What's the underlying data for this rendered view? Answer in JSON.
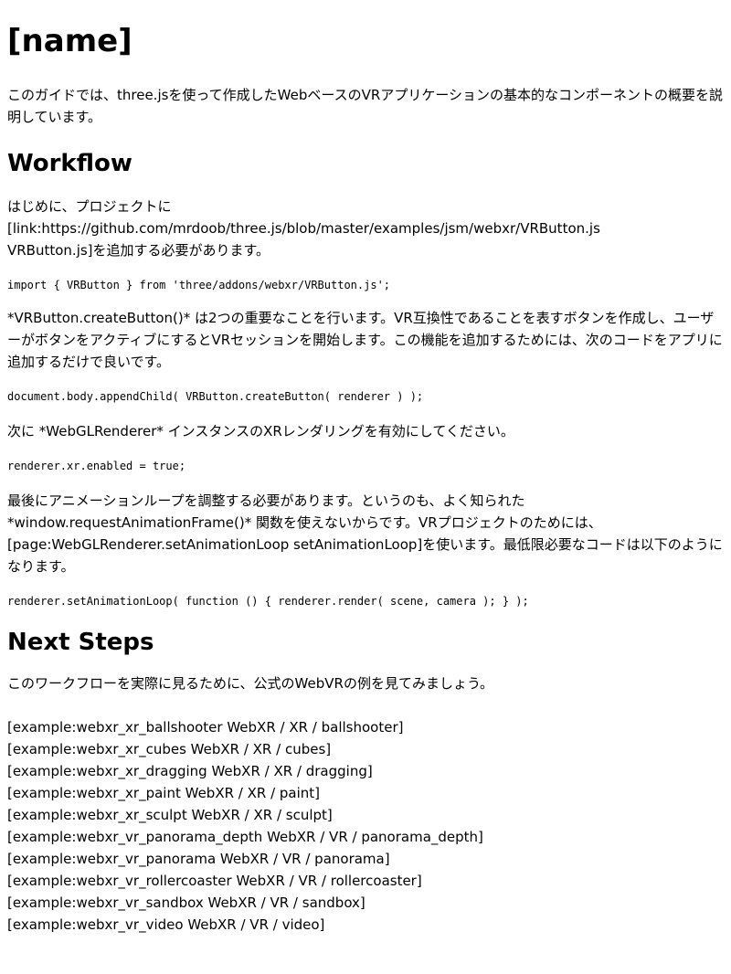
{
  "title": "[name]",
  "intro": "このガイドでは、three.jsを使って作成したWebベースのVRアプリケーションの基本的なコンポーネントの概要を説明しています。",
  "workflow": {
    "heading": "Workflow",
    "p1": "はじめに、プロジェクトに\n[link:https://github.com/mrdoob/three.js/blob/master/examples/jsm/webxr/VRButton.js\nVRButton.js]を追加する必要があります。",
    "code1": "import { VRButton } from 'three/addons/webxr/VRButton.js';",
    "p2": "*VRButton.createButton()* は2つの重要なことを行います。VR互換性であることを表すボタンを作成し、ユーザーがボタンをアクティブにするとVRセッションを開始します。この機能を追加するためには、次のコードをアプリに追加するだけで良いです。",
    "code2": "document.body.appendChild( VRButton.createButton( renderer ) );",
    "p3": "次に *WebGLRenderer* インスタンスのXRレンダリングを有効にしてください。",
    "code3": "renderer.xr.enabled = true;",
    "p4": "最後にアニメーションループを調整する必要があります。というのも、よく知られた\n*window.requestAnimationFrame()* 関数を使えないからです。VRプロジェクトのためには、\n[page:WebGLRenderer.setAnimationLoop setAnimationLoop]を使います。最低限必要なコードは以下のようになります。",
    "code4": "renderer.setAnimationLoop( function () { renderer.render( scene, camera ); } );"
  },
  "next_steps": {
    "heading": "Next Steps",
    "p1": "このワークフローを実際に見るために、公式のWebVRの例を見てみましょう。",
    "examples": [
      "[example:webxr_xr_ballshooter WebXR / XR / ballshooter]",
      "[example:webxr_xr_cubes WebXR / XR / cubes]",
      "[example:webxr_xr_dragging WebXR / XR / dragging]",
      "[example:webxr_xr_paint WebXR / XR / paint]",
      "[example:webxr_xr_sculpt WebXR / XR / sculpt]",
      "[example:webxr_vr_panorama_depth WebXR / VR / panorama_depth]",
      "[example:webxr_vr_panorama WebXR / VR / panorama]",
      "[example:webxr_vr_rollercoaster WebXR / VR / rollercoaster]",
      "[example:webxr_vr_sandbox WebXR / VR / sandbox]",
      "[example:webxr_vr_video WebXR / VR / video]"
    ]
  }
}
